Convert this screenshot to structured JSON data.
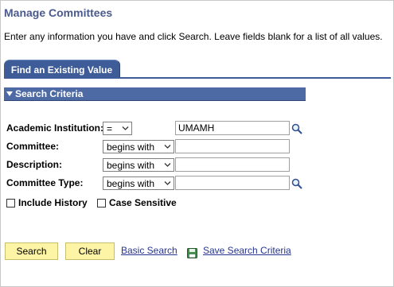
{
  "page": {
    "title": "Manage Committees",
    "instructions": "Enter any information you have and click Search. Leave fields blank for a list of all values."
  },
  "tabs": [
    {
      "label": "Find an Existing Value"
    }
  ],
  "section": {
    "title": "Search Criteria"
  },
  "criteria": [
    {
      "label": "Academic Institution:",
      "operator": "=",
      "value": "UMAMH",
      "has_lookup": true
    },
    {
      "label": "Committee:",
      "operator": "begins with",
      "value": "",
      "has_lookup": false
    },
    {
      "label": "Description:",
      "operator": "begins with",
      "value": "",
      "has_lookup": false
    },
    {
      "label": "Committee Type:",
      "operator": "begins with",
      "value": "",
      "has_lookup": true
    }
  ],
  "options": {
    "include_history": {
      "label": "Include History",
      "checked": false
    },
    "case_sensitive": {
      "label": "Case Sensitive",
      "checked": false
    }
  },
  "actions": {
    "search_label": "Search",
    "clear_label": "Clear",
    "basic_search_label": "Basic Search",
    "save_criteria_label": "Save Search Criteria"
  },
  "icons": {
    "lookup": "magnifier-icon",
    "save": "floppy-disk-icon",
    "dropdown": "chevron-down-icon",
    "section_toggle": "triangle-down-icon"
  },
  "colors": {
    "title": "#4b5a8c",
    "tab_bg": "#3d5c98",
    "section_bg": "#4d6aa5",
    "button_bg": "#fdf4a6",
    "link": "#25348f"
  }
}
